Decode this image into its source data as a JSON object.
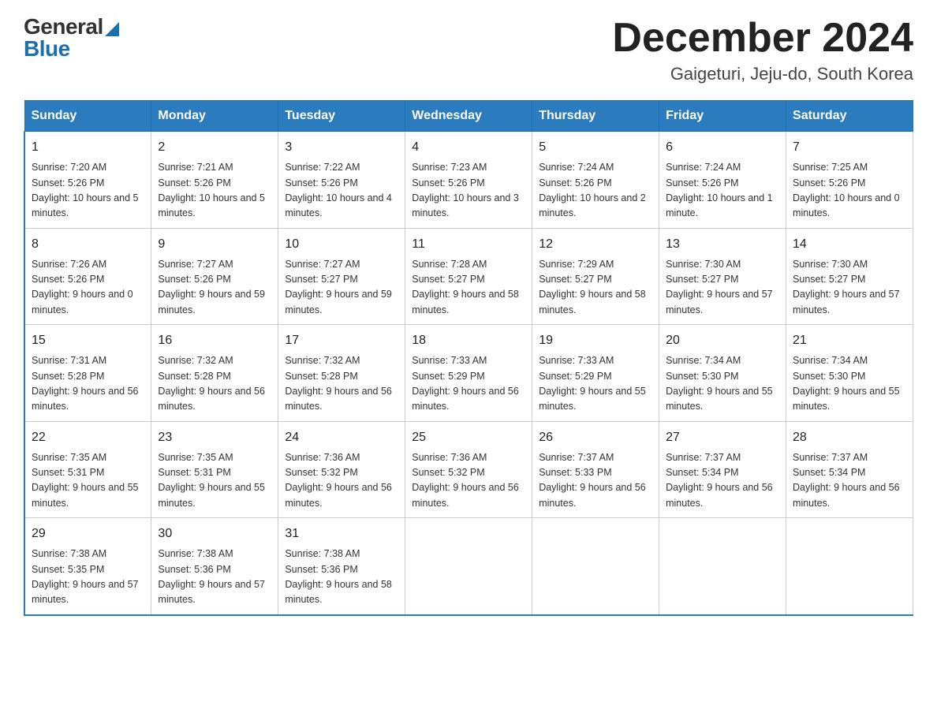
{
  "header": {
    "title": "December 2024",
    "subtitle": "Gaigeturi, Jeju-do, South Korea"
  },
  "logo": {
    "general": "General",
    "blue": "Blue"
  },
  "calendar": {
    "days": [
      "Sunday",
      "Monday",
      "Tuesday",
      "Wednesday",
      "Thursday",
      "Friday",
      "Saturday"
    ],
    "weeks": [
      [
        {
          "date": "1",
          "sunrise": "7:20 AM",
          "sunset": "5:26 PM",
          "daylight": "10 hours and 5 minutes."
        },
        {
          "date": "2",
          "sunrise": "7:21 AM",
          "sunset": "5:26 PM",
          "daylight": "10 hours and 5 minutes."
        },
        {
          "date": "3",
          "sunrise": "7:22 AM",
          "sunset": "5:26 PM",
          "daylight": "10 hours and 4 minutes."
        },
        {
          "date": "4",
          "sunrise": "7:23 AM",
          "sunset": "5:26 PM",
          "daylight": "10 hours and 3 minutes."
        },
        {
          "date": "5",
          "sunrise": "7:24 AM",
          "sunset": "5:26 PM",
          "daylight": "10 hours and 2 minutes."
        },
        {
          "date": "6",
          "sunrise": "7:24 AM",
          "sunset": "5:26 PM",
          "daylight": "10 hours and 1 minute."
        },
        {
          "date": "7",
          "sunrise": "7:25 AM",
          "sunset": "5:26 PM",
          "daylight": "10 hours and 0 minutes."
        }
      ],
      [
        {
          "date": "8",
          "sunrise": "7:26 AM",
          "sunset": "5:26 PM",
          "daylight": "9 hours and 0 minutes."
        },
        {
          "date": "9",
          "sunrise": "7:27 AM",
          "sunset": "5:26 PM",
          "daylight": "9 hours and 59 minutes."
        },
        {
          "date": "10",
          "sunrise": "7:27 AM",
          "sunset": "5:27 PM",
          "daylight": "9 hours and 59 minutes."
        },
        {
          "date": "11",
          "sunrise": "7:28 AM",
          "sunset": "5:27 PM",
          "daylight": "9 hours and 58 minutes."
        },
        {
          "date": "12",
          "sunrise": "7:29 AM",
          "sunset": "5:27 PM",
          "daylight": "9 hours and 58 minutes."
        },
        {
          "date": "13",
          "sunrise": "7:30 AM",
          "sunset": "5:27 PM",
          "daylight": "9 hours and 57 minutes."
        },
        {
          "date": "14",
          "sunrise": "7:30 AM",
          "sunset": "5:27 PM",
          "daylight": "9 hours and 57 minutes."
        }
      ],
      [
        {
          "date": "15",
          "sunrise": "7:31 AM",
          "sunset": "5:28 PM",
          "daylight": "9 hours and 56 minutes."
        },
        {
          "date": "16",
          "sunrise": "7:32 AM",
          "sunset": "5:28 PM",
          "daylight": "9 hours and 56 minutes."
        },
        {
          "date": "17",
          "sunrise": "7:32 AM",
          "sunset": "5:28 PM",
          "daylight": "9 hours and 56 minutes."
        },
        {
          "date": "18",
          "sunrise": "7:33 AM",
          "sunset": "5:29 PM",
          "daylight": "9 hours and 56 minutes."
        },
        {
          "date": "19",
          "sunrise": "7:33 AM",
          "sunset": "5:29 PM",
          "daylight": "9 hours and 55 minutes."
        },
        {
          "date": "20",
          "sunrise": "7:34 AM",
          "sunset": "5:30 PM",
          "daylight": "9 hours and 55 minutes."
        },
        {
          "date": "21",
          "sunrise": "7:34 AM",
          "sunset": "5:30 PM",
          "daylight": "9 hours and 55 minutes."
        }
      ],
      [
        {
          "date": "22",
          "sunrise": "7:35 AM",
          "sunset": "5:31 PM",
          "daylight": "9 hours and 55 minutes."
        },
        {
          "date": "23",
          "sunrise": "7:35 AM",
          "sunset": "5:31 PM",
          "daylight": "9 hours and 55 minutes."
        },
        {
          "date": "24",
          "sunrise": "7:36 AM",
          "sunset": "5:32 PM",
          "daylight": "9 hours and 56 minutes."
        },
        {
          "date": "25",
          "sunrise": "7:36 AM",
          "sunset": "5:32 PM",
          "daylight": "9 hours and 56 minutes."
        },
        {
          "date": "26",
          "sunrise": "7:37 AM",
          "sunset": "5:33 PM",
          "daylight": "9 hours and 56 minutes."
        },
        {
          "date": "27",
          "sunrise": "7:37 AM",
          "sunset": "5:34 PM",
          "daylight": "9 hours and 56 minutes."
        },
        {
          "date": "28",
          "sunrise": "7:37 AM",
          "sunset": "5:34 PM",
          "daylight": "9 hours and 56 minutes."
        }
      ],
      [
        {
          "date": "29",
          "sunrise": "7:38 AM",
          "sunset": "5:35 PM",
          "daylight": "9 hours and 57 minutes."
        },
        {
          "date": "30",
          "sunrise": "7:38 AM",
          "sunset": "5:36 PM",
          "daylight": "9 hours and 57 minutes."
        },
        {
          "date": "31",
          "sunrise": "7:38 AM",
          "sunset": "5:36 PM",
          "daylight": "9 hours and 58 minutes."
        },
        null,
        null,
        null,
        null
      ]
    ]
  }
}
